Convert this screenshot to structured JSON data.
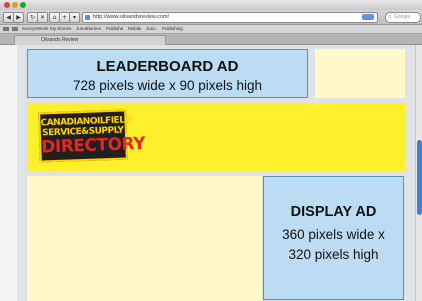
{
  "browser": {
    "url": "http://www.oilsandsreview.com/",
    "search_placeholder": "Google",
    "bookmarks": [
      "SunnyvWeek",
      "My Stories",
      "JunoBlurries",
      "Publishe",
      "Mobile",
      "Juno",
      "Publishing"
    ],
    "tab_title": "Oilsands Review"
  },
  "leaderboard": {
    "title": "LEADERBOARD AD",
    "subtitle": "728 pixels wide x 90 pixels high"
  },
  "logo": {
    "line1": "CANADIANOILFIELD",
    "line2": "SERVICE&SUPPLY",
    "line3": "DIRECTORY"
  },
  "display_ad": {
    "title": "DISPLAY AD",
    "line1": "360 pixels wide x",
    "line2": "320 pixels high"
  },
  "colors": {
    "ad_blue": "#bcdcf4",
    "band_yellow": "#fff02b",
    "filler_cream": "#fff8c8",
    "scroll_blue": "#3f7fd6"
  }
}
